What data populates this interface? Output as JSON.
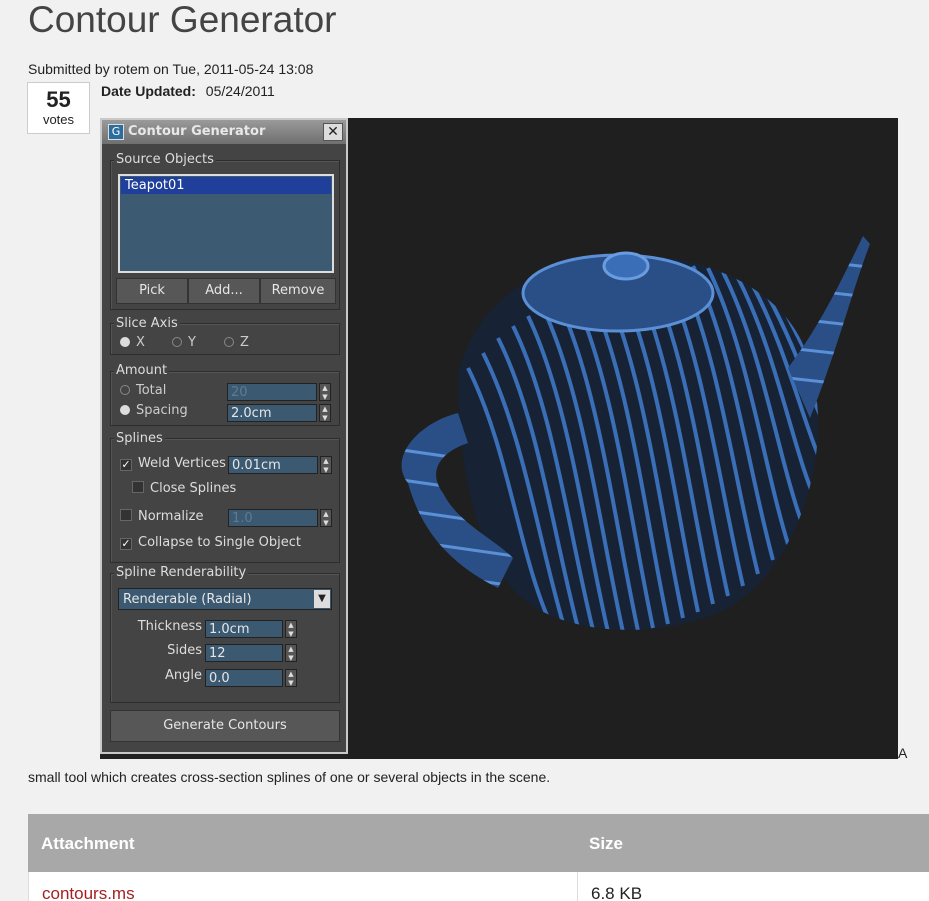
{
  "page": {
    "title": "Contour Generator",
    "submitted": "Submitted by rotem on Tue, 2011-05-24 13:08",
    "votes_count": "55",
    "votes_label": "votes",
    "date_updated_label": "Date Updated:",
    "date_updated_value": "05/24/2011",
    "description_tail": "A",
    "description": "small tool which creates cross-section splines of one or several objects in the scene."
  },
  "dialog": {
    "title": "Contour Generator",
    "close": "✕",
    "source_objects": {
      "legend": "Source Objects",
      "items": [
        "Teapot01"
      ],
      "pick": "Pick",
      "add": "Add...",
      "remove": "Remove"
    },
    "slice_axis": {
      "legend": "Slice Axis",
      "x": "X",
      "y": "Y",
      "z": "Z",
      "selected": "X"
    },
    "amount": {
      "legend": "Amount",
      "total_label": "Total",
      "total_value": "20",
      "spacing_label": "Spacing",
      "spacing_value": "2.0cm",
      "selected": "Spacing"
    },
    "splines": {
      "legend": "Splines",
      "weld_label": "Weld Vertices",
      "weld_checked": true,
      "weld_value": "0.01cm",
      "close_label": "Close Splines",
      "close_checked": false,
      "normalize_label": "Normalize",
      "normalize_checked": false,
      "normalize_value": "1.0",
      "collapse_label": "Collapse to Single Object",
      "collapse_checked": true
    },
    "renderability": {
      "legend": "Spline Renderability",
      "mode": "Renderable (Radial)",
      "thickness_label": "Thickness",
      "thickness_value": "1.0cm",
      "sides_label": "Sides",
      "sides_value": "12",
      "angle_label": "Angle",
      "angle_value": "0.0"
    },
    "generate": "Generate Contours"
  },
  "attachments": {
    "header_attachment": "Attachment",
    "header_size": "Size",
    "rows": [
      {
        "name": "contours.ms",
        "size": "6.8 KB"
      }
    ]
  },
  "colors": {
    "teapot": "#3a6fb8",
    "link": "#a42121",
    "table_header": "#a8a8a8"
  }
}
